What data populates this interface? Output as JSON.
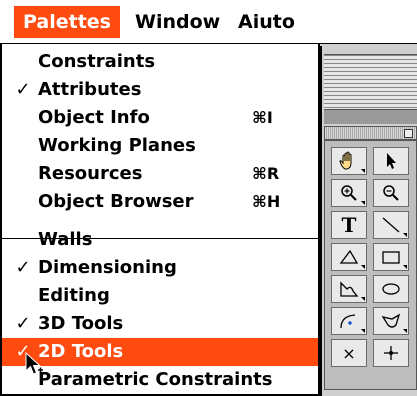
{
  "menubar": {
    "items": [
      {
        "label": "Palettes"
      },
      {
        "label": "Window"
      },
      {
        "label": "Aiuto"
      }
    ]
  },
  "menu": {
    "items": [
      {
        "label": "Constraints",
        "checked": false,
        "shortcut": ""
      },
      {
        "label": "Attributes",
        "checked": true,
        "shortcut": ""
      },
      {
        "label": "Object Info",
        "checked": false,
        "shortcut": "⌘I"
      },
      {
        "label": "Working Planes",
        "checked": false,
        "shortcut": ""
      },
      {
        "label": "Resources",
        "checked": false,
        "shortcut": "⌘R"
      },
      {
        "label": "Object Browser",
        "checked": false,
        "shortcut": "⌘H"
      },
      {
        "label": "Walls",
        "checked": false,
        "shortcut": ""
      },
      {
        "label": "Dimensioning",
        "checked": true,
        "shortcut": ""
      },
      {
        "label": "Editing",
        "checked": false,
        "shortcut": ""
      },
      {
        "label": "3D Tools",
        "checked": true,
        "shortcut": ""
      },
      {
        "label": "2D Tools",
        "checked": true,
        "shortcut": "",
        "highlighted": true
      },
      {
        "label": "Parametric Constraints",
        "checked": false,
        "shortcut": ""
      }
    ],
    "check_glyph": "✓"
  },
  "tool_palette": {
    "tools": [
      "pan-hand-icon",
      "selection-arrow-icon",
      "zoom-in-icon",
      "zoom-out-icon",
      "text-tool-icon",
      "line-tool-icon",
      "polygon-tool-icon",
      "rectangle-tool-icon",
      "freehand-polyline-icon",
      "oval-tool-icon",
      "arc-tool-icon",
      "polyline-curve-icon",
      "delete-x-icon",
      "locus-point-icon"
    ],
    "text_tool_glyph": "T",
    "delete_glyph": "×"
  },
  "colors": {
    "highlight": "#ff4a10",
    "menu_bg": "#ffffff",
    "palette_bg": "#bdbdbd"
  }
}
